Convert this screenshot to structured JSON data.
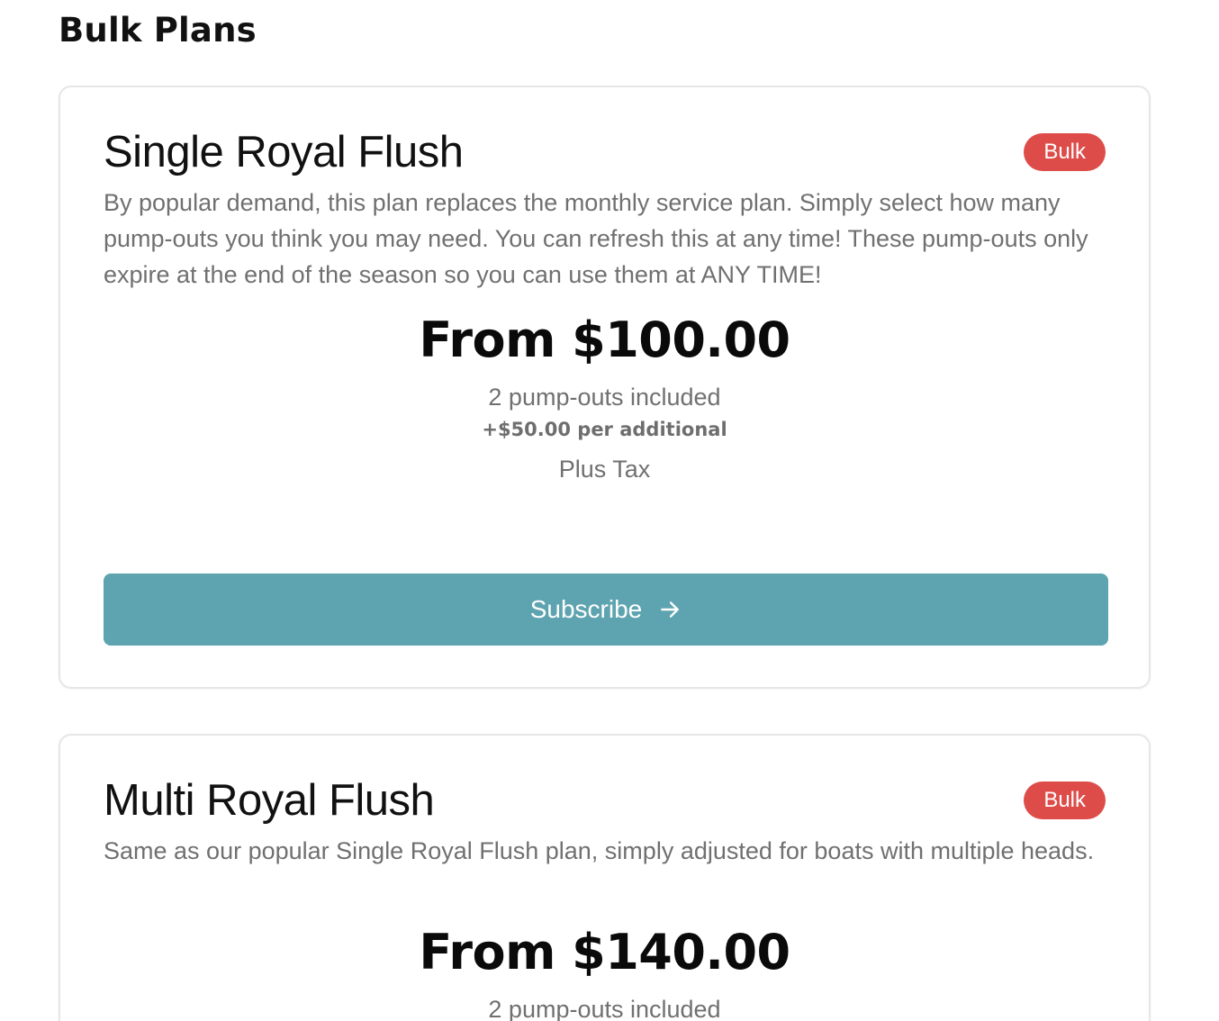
{
  "section": {
    "title": "Bulk Plans"
  },
  "plans": [
    {
      "name": "Single Royal Flush",
      "badge": "Bulk",
      "description": "By popular demand, this plan replaces the monthly service plan. Simply select how many pump-outs you think you may need. You can refresh this at any time! These pump-outs only expire at the end of the season so you can use them at ANY TIME!",
      "price": "From $100.00",
      "included": "2 pump-outs included",
      "additional": "+$50.00 per additional",
      "tax": "Plus Tax",
      "button_label": "Subscribe",
      "button_icon": "arrow-right-icon"
    },
    {
      "name": "Multi Royal Flush",
      "badge": "Bulk",
      "description": "Same as our popular Single Royal Flush plan, simply adjusted for boats with multiple heads.",
      "price": "From $140.00",
      "included": "2 pump-outs included"
    }
  ],
  "colors": {
    "badge_bg": "#de4c4a",
    "button_bg": "#5ea4b0",
    "muted_text": "#707070",
    "card_border": "#e6e6e6"
  }
}
